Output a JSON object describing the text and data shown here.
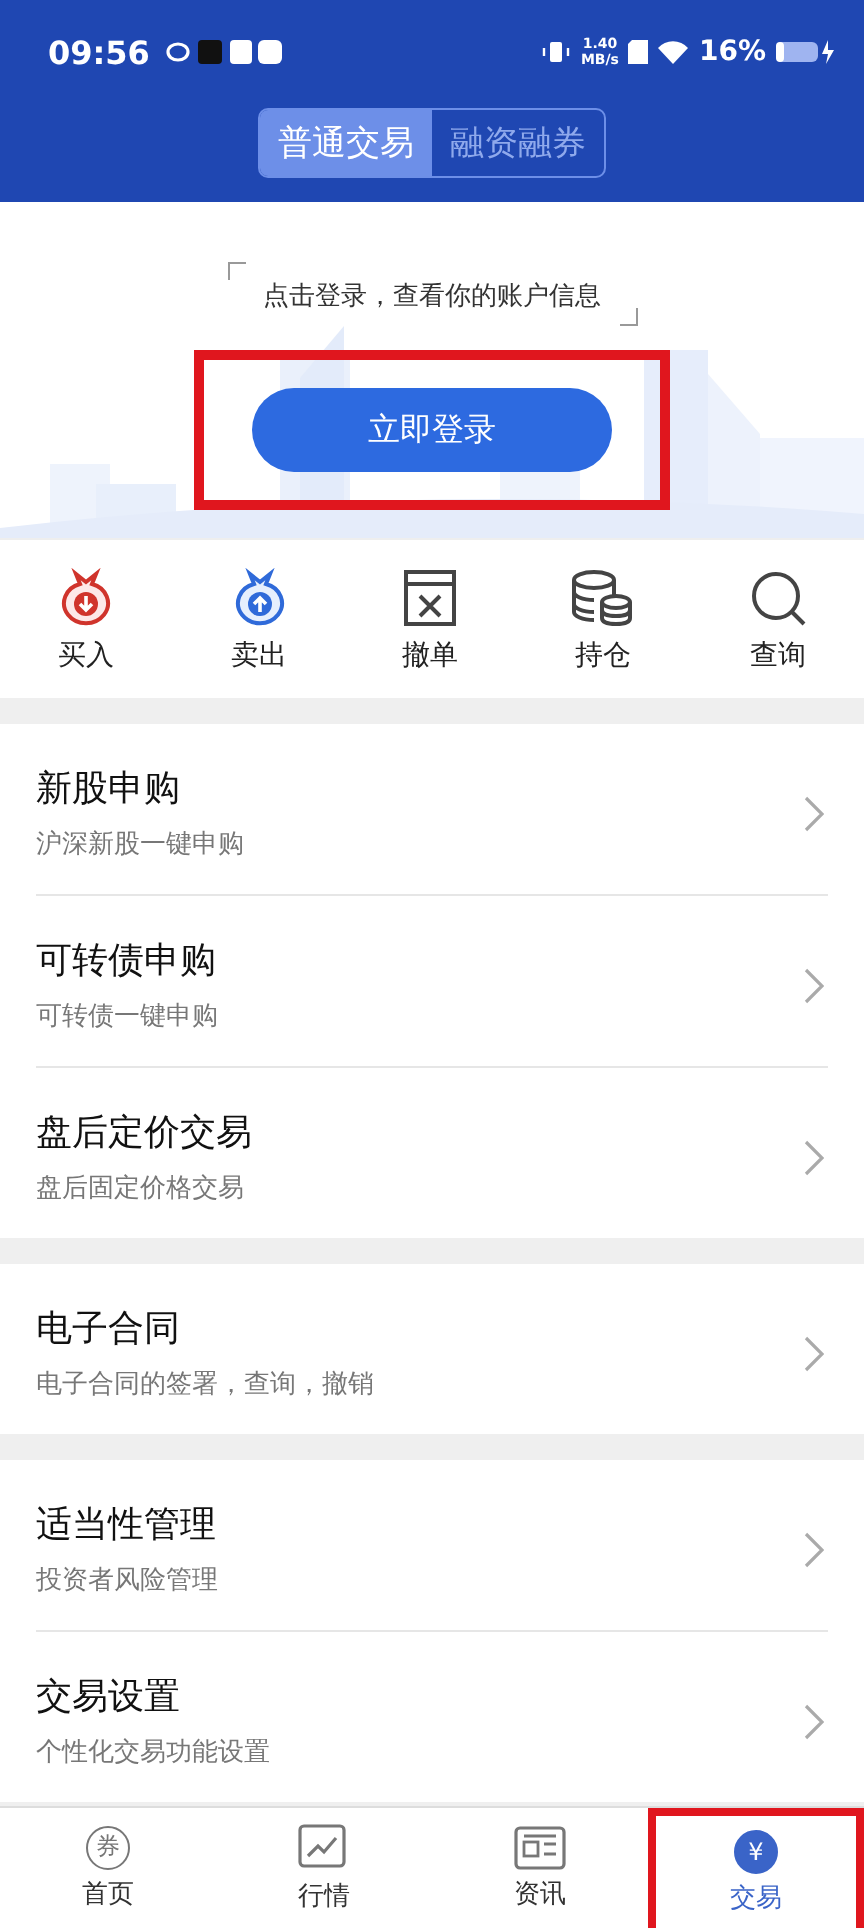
{
  "status_bar": {
    "time": "09:56",
    "speed_value": "1.40",
    "speed_unit": "MB/s",
    "battery": "16%"
  },
  "segments": [
    {
      "label": "普通交易",
      "selected": true
    },
    {
      "label": "融资融券",
      "selected": false
    }
  ],
  "login": {
    "prompt": "点击登录，查看你的账户信息",
    "button": "立即登录",
    "highlighted": true
  },
  "quick_actions": [
    {
      "label": "买入",
      "kind": "buy"
    },
    {
      "label": "卖出",
      "kind": "sell"
    },
    {
      "label": "撤单",
      "kind": "cancel"
    },
    {
      "label": "持仓",
      "kind": "holdings"
    },
    {
      "label": "查询",
      "kind": "search"
    }
  ],
  "menu_groups": [
    [
      {
        "title": "新股申购",
        "subtitle": "沪深新股一键申购"
      },
      {
        "title": "可转债申购",
        "subtitle": "可转债一键申购"
      },
      {
        "title": "盘后定价交易",
        "subtitle": "盘后固定价格交易"
      }
    ],
    [
      {
        "title": "电子合同",
        "subtitle": "电子合同的签署，查询，撤销"
      }
    ],
    [
      {
        "title": "适当性管理",
        "subtitle": "投资者风险管理"
      },
      {
        "title": "交易设置",
        "subtitle": "个性化交易功能设置"
      }
    ]
  ],
  "bottom_nav": [
    {
      "label": "首页",
      "kind": "home",
      "icon_text": "券",
      "selected": false,
      "highlighted": false
    },
    {
      "label": "行情",
      "kind": "market",
      "selected": false,
      "highlighted": false
    },
    {
      "label": "资讯",
      "kind": "news",
      "selected": false,
      "highlighted": false
    },
    {
      "label": "交易",
      "kind": "trade",
      "icon_text": "¥",
      "selected": true,
      "highlighted": true
    }
  ]
}
